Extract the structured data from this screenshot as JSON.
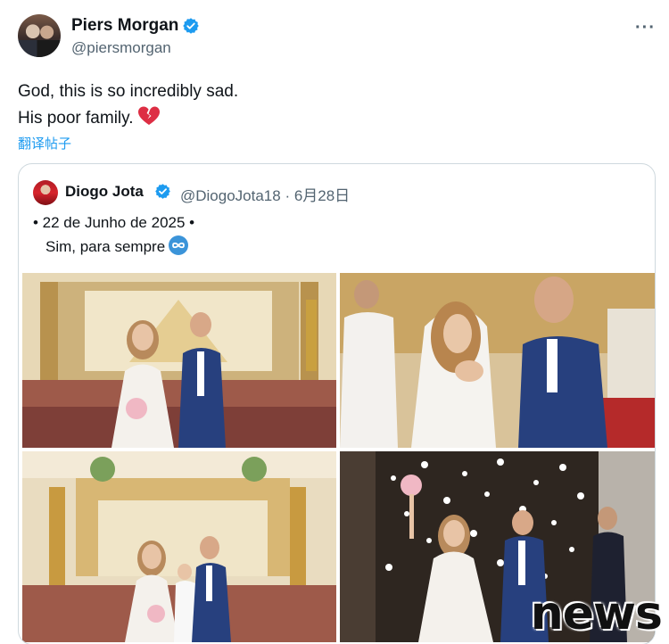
{
  "author": {
    "display_name": "Piers Morgan",
    "handle": "@piersmorgan",
    "verified": true,
    "more_label": "···"
  },
  "tweet": {
    "line1": "God, this is so incredibly sad.",
    "line2": "His poor family.",
    "emoji": "broken-heart-icon",
    "translate_label": "翻译帖子"
  },
  "quoted": {
    "display_name": "Diogo Jota",
    "verified": true,
    "handle_date": "@DiogoJota18 · 6月28日",
    "line1": "• 22 de Junho de 2025 •",
    "line2": "Sim, para sempre",
    "emoji": "infinity-icon",
    "photos": [
      "wedding-photo-altar",
      "wedding-photo-ring",
      "wedding-photo-family",
      "wedding-photo-exit"
    ]
  },
  "watermark": "news",
  "colors": {
    "link": "#1d9bf0",
    "verified": "#1d9bf0",
    "muted": "#536471",
    "border": "#cfd9de"
  }
}
